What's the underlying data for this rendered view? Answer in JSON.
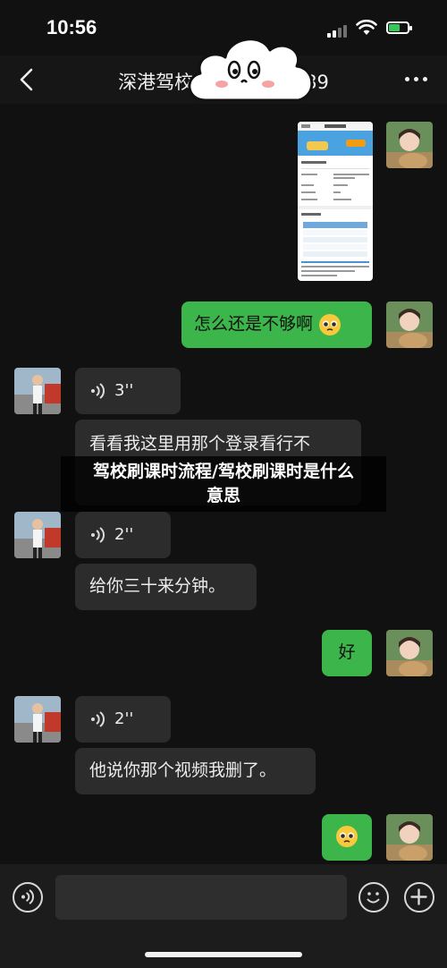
{
  "status_bar": {
    "time": "10:56"
  },
  "header": {
    "title": "深港驾校-",
    "title_suffix": "289"
  },
  "messages": [
    {
      "side": "out",
      "type": "image",
      "description": "registration-screenshot"
    },
    {
      "side": "out",
      "type": "text",
      "text": "怎么还是不够啊",
      "emoji": "pleading-face"
    },
    {
      "side": "in",
      "type": "voice",
      "duration": "3''"
    },
    {
      "side": "in",
      "type": "text",
      "text": "看看我这里用那个登录看行不"
    },
    {
      "side": "in",
      "type": "voice",
      "duration": "2''"
    },
    {
      "side": "in",
      "type": "text",
      "text": "给你三十来分钟。"
    },
    {
      "side": "out",
      "type": "text",
      "text": "好"
    },
    {
      "side": "in",
      "type": "voice",
      "duration": "2''"
    },
    {
      "side": "in",
      "type": "text",
      "text": "他说你那个视频我删了。"
    },
    {
      "side": "out",
      "type": "emoji",
      "emoji": "pleading-face"
    }
  ],
  "overlay": {
    "line1": "驾校刷课时流程/驾校刷课时是什么",
    "line2": "意思"
  },
  "colors": {
    "background": "#111111",
    "outgoing_bubble": "#3cb54a",
    "incoming_bubble": "#2c2c2c"
  }
}
